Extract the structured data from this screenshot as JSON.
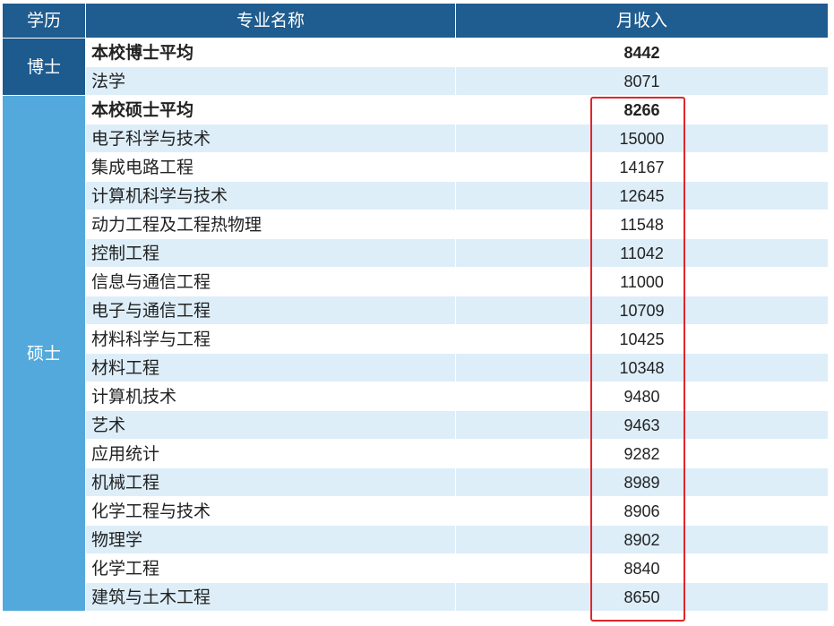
{
  "headers": {
    "degree": "学历",
    "major": "专业名称",
    "income": "月收入"
  },
  "doctor": {
    "label": "博士",
    "rows": [
      {
        "name": "本校博士平均",
        "value": "8442",
        "bold": true
      },
      {
        "name": "法学",
        "value": "8071",
        "bold": false
      }
    ]
  },
  "master": {
    "label": "硕士",
    "rows": [
      {
        "name": "本校硕士平均",
        "value": "8266",
        "bold": true
      },
      {
        "name": "电子科学与技术",
        "value": "15000",
        "bold": false
      },
      {
        "name": "集成电路工程",
        "value": "14167",
        "bold": false
      },
      {
        "name": "计算机科学与技术",
        "value": "12645",
        "bold": false
      },
      {
        "name": "动力工程及工程热物理",
        "value": "11548",
        "bold": false
      },
      {
        "name": "控制工程",
        "value": "11042",
        "bold": false
      },
      {
        "name": "信息与通信工程",
        "value": "11000",
        "bold": false
      },
      {
        "name": "电子与通信工程",
        "value": "10709",
        "bold": false
      },
      {
        "name": "材料科学与工程",
        "value": "10425",
        "bold": false
      },
      {
        "name": "材料工程",
        "value": "10348",
        "bold": false
      },
      {
        "name": "计算机技术",
        "value": "9480",
        "bold": false
      },
      {
        "name": "艺术",
        "value": "9463",
        "bold": false
      },
      {
        "name": "应用统计",
        "value": "9282",
        "bold": false
      },
      {
        "name": "机械工程",
        "value": "8989",
        "bold": false
      },
      {
        "name": "化学工程与技术",
        "value": "8906",
        "bold": false
      },
      {
        "name": "物理学",
        "value": "8902",
        "bold": false
      },
      {
        "name": "化学工程",
        "value": "8840",
        "bold": false
      },
      {
        "name": "建筑与土木工程",
        "value": "8650",
        "bold": false
      }
    ]
  },
  "colors": {
    "header": "#1f5c8f",
    "degree_dark": "#1d5a8e",
    "degree_light": "#53a9db",
    "row_alt": "#ddeef9",
    "highlight": "#e0262a"
  }
}
